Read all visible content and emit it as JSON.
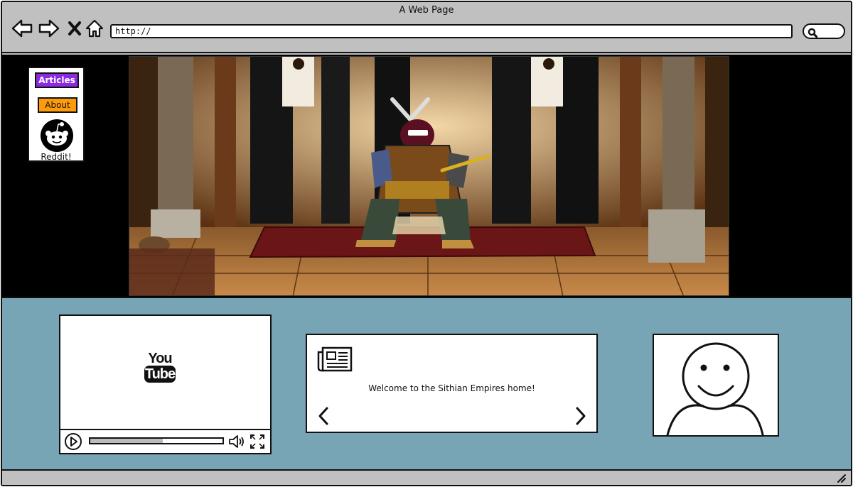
{
  "window": {
    "title": "A Web Page"
  },
  "toolbar": {
    "url": "http://",
    "icons": [
      "back-arrow-icon",
      "forward-arrow-icon",
      "close-x-icon",
      "home-icon",
      "search-icon"
    ]
  },
  "sidebar": {
    "items": [
      {
        "label": "Articles",
        "color": "#8a2be2"
      },
      {
        "label": "About",
        "color": "#ff9a0a"
      }
    ],
    "reddit_label": "Reddit!"
  },
  "hero": {
    "image": "samurai-in-dojo-photo"
  },
  "video": {
    "logo_top": "You",
    "logo_bottom": "Tube",
    "progress": 0.55
  },
  "carousel": {
    "text": "Welcome to the Sithian Empires home!",
    "icon": "newspaper-icon"
  },
  "colors": {
    "content_bg": "#77a5b5",
    "chrome": "#c0c0c0",
    "hero_bg": "#000000"
  }
}
